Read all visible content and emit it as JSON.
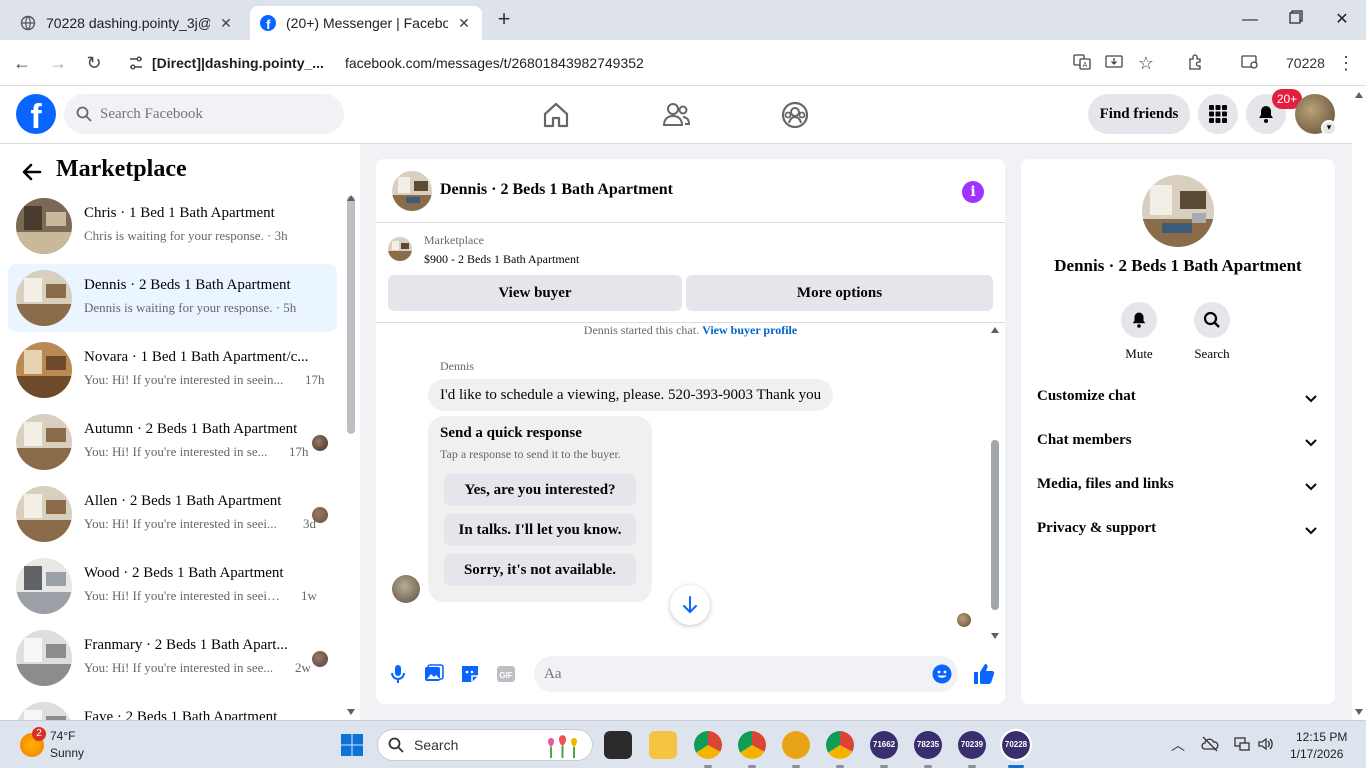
{
  "browser": {
    "tabs": [
      {
        "label": "70228 dashing.pointy_3j@"
      },
      {
        "label": "(20+) Messenger | Faceboo"
      }
    ],
    "site_info": "[Direct]|dashing.pointy_...",
    "url": "facebook.com/messages/t/26801843982749352",
    "profile_label": "70228"
  },
  "fb_header": {
    "logo_letter": "f",
    "search_placeholder": "Search Facebook",
    "find_friends": "Find friends",
    "notification_count": "20+"
  },
  "sidebar": {
    "title": "Marketplace",
    "conversations": [
      {
        "name": "Chris · 1 Bed 1 Bath Apartment",
        "preview": "Chris is waiting for your response. · 3h",
        "time": "",
        "active": false
      },
      {
        "name": "Dennis · 2 Beds 1 Bath Apartment",
        "preview": "Dennis is waiting for your response. · 5h",
        "time": "",
        "active": true
      },
      {
        "name": "Novara · 1 Bed 1 Bath Apartment/c...",
        "preview": "You: Hi! If you're interested in seein...",
        "time": "17h",
        "active": false
      },
      {
        "name": "Autumn · 2 Beds 1 Bath Apartment",
        "preview": "You: Hi! If you're interested in se...",
        "time": "17h",
        "active": false
      },
      {
        "name": "Allen · 2 Beds 1 Bath Apartment",
        "preview": "You: Hi! If you're interested in seei...",
        "time": "3d",
        "active": false
      },
      {
        "name": "Wood · 2 Beds 1 Bath Apartment",
        "preview": "You: Hi! If you're interested in seeing...",
        "time": "1w",
        "active": false
      },
      {
        "name": "Franmary · 2 Beds 1 Bath Apart...",
        "preview": "You: Hi! If you're interested in see...",
        "time": "2w",
        "active": false
      },
      {
        "name": "Faye · 2 Beds 1 Bath Apartment",
        "preview": "",
        "time": "",
        "active": false
      }
    ]
  },
  "chat": {
    "title": "Dennis · 2 Beds 1 Bath Apartment",
    "marketplace_label": "Marketplace",
    "listing": "$900 - 2 Beds 1 Bath Apartment",
    "view_buyer": "View buyer",
    "more_options": "More options",
    "started_text": "Dennis started this chat.",
    "view_buyer_profile": "View buyer profile",
    "sender_name": "Dennis",
    "message": "I'd like to schedule a viewing, please. 520-393-9003 Thank you",
    "quick_response": {
      "title": "Send a quick response",
      "subtitle": "Tap a response to send it to the buyer.",
      "options": [
        "Yes, are you interested?",
        "In talks. I'll let you know.",
        "Sorry, it's not available."
      ]
    },
    "input_placeholder": "Aa"
  },
  "info_panel": {
    "name": "Dennis · 2 Beds 1 Bath Apartment",
    "actions": [
      "Mute",
      "Search"
    ],
    "sections": [
      "Customize chat",
      "Chat members",
      "Media, files and links",
      "Privacy & support"
    ]
  },
  "taskbar": {
    "weather_badge": "2",
    "temperature": "74°F",
    "condition": "Sunny",
    "search_label": "Search",
    "apps": [
      "71662",
      "78235",
      "70239",
      "70228"
    ],
    "time": "12:15 PM",
    "date": "1/17/2026"
  },
  "colors": {
    "fb_blue": "#0866ff",
    "active_row": "#ebf5ff",
    "link_blue": "#0064d1",
    "info_purple": "#a033ff",
    "badge_red": "#e41e3f"
  }
}
